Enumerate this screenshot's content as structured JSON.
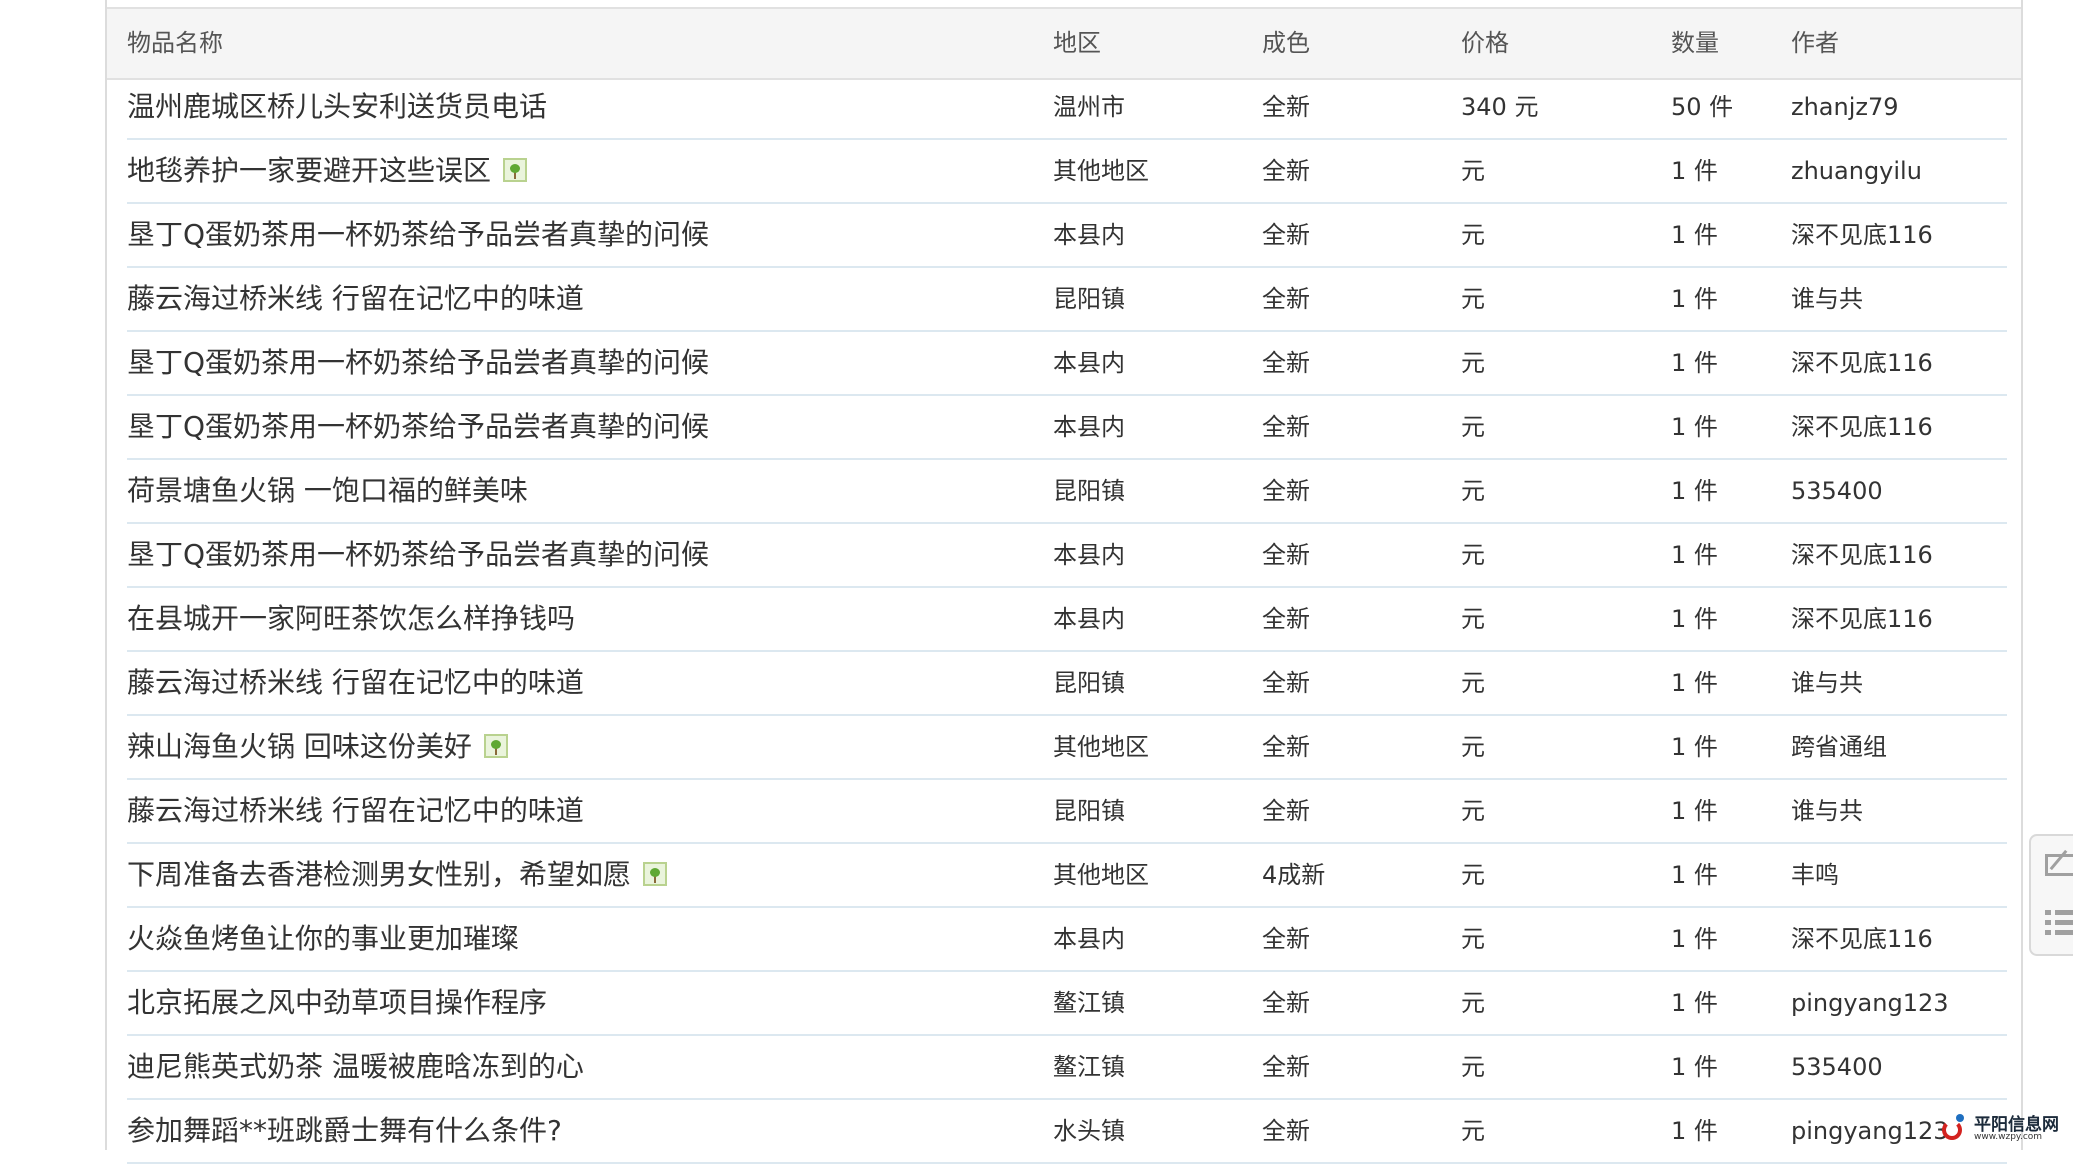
{
  "columns": {
    "title": "物品名称",
    "area": "地区",
    "condition": "成色",
    "price": "价格",
    "quantity": "数量",
    "author": "作者"
  },
  "rows": [
    {
      "title": "温州鹿城区桥儿头安利送货员电话",
      "has_image": false,
      "area": "温州市",
      "condition": "全新",
      "price": "340 元",
      "quantity": "50 件",
      "author": "zhanjz79"
    },
    {
      "title": "地毯养护一家要避开这些误区",
      "has_image": true,
      "area": "其他地区",
      "condition": "全新",
      "price": "元",
      "quantity": "1 件",
      "author": "zhuangyilu"
    },
    {
      "title": "垦丁Q蛋奶茶用一杯奶茶给予品尝者真挚的问候",
      "has_image": false,
      "area": "本县内",
      "condition": "全新",
      "price": "元",
      "quantity": "1 件",
      "author": "深不见底116"
    },
    {
      "title": "藤云海过桥米线 行留在记忆中的味道",
      "has_image": false,
      "area": "昆阳镇",
      "condition": "全新",
      "price": "元",
      "quantity": "1 件",
      "author": "谁与共"
    },
    {
      "title": "垦丁Q蛋奶茶用一杯奶茶给予品尝者真挚的问候",
      "has_image": false,
      "area": "本县内",
      "condition": "全新",
      "price": "元",
      "quantity": "1 件",
      "author": "深不见底116"
    },
    {
      "title": "垦丁Q蛋奶茶用一杯奶茶给予品尝者真挚的问候",
      "has_image": false,
      "area": "本县内",
      "condition": "全新",
      "price": "元",
      "quantity": "1 件",
      "author": "深不见底116"
    },
    {
      "title": "荷景塘鱼火锅 一饱口福的鲜美味",
      "has_image": false,
      "area": "昆阳镇",
      "condition": "全新",
      "price": "元",
      "quantity": "1 件",
      "author": "535400"
    },
    {
      "title": "垦丁Q蛋奶茶用一杯奶茶给予品尝者真挚的问候",
      "has_image": false,
      "area": "本县内",
      "condition": "全新",
      "price": "元",
      "quantity": "1 件",
      "author": "深不见底116"
    },
    {
      "title": "在县城开一家阿旺茶饮怎么样挣钱吗",
      "has_image": false,
      "area": "本县内",
      "condition": "全新",
      "price": "元",
      "quantity": "1 件",
      "author": "深不见底116"
    },
    {
      "title": "藤云海过桥米线 行留在记忆中的味道",
      "has_image": false,
      "area": "昆阳镇",
      "condition": "全新",
      "price": "元",
      "quantity": "1 件",
      "author": "谁与共"
    },
    {
      "title": "辣山海鱼火锅 回味这份美好",
      "has_image": true,
      "area": "其他地区",
      "condition": "全新",
      "price": "元",
      "quantity": "1 件",
      "author": "跨省通组"
    },
    {
      "title": "藤云海过桥米线 行留在记忆中的味道",
      "has_image": false,
      "area": "昆阳镇",
      "condition": "全新",
      "price": "元",
      "quantity": "1 件",
      "author": "谁与共"
    },
    {
      "title": "下周准备去香港检测男女性别，希望如愿",
      "has_image": true,
      "area": "其他地区",
      "condition": "4成新",
      "price": "元",
      "quantity": "1 件",
      "author": "丰鸣"
    },
    {
      "title": "火焱鱼烤鱼让你的事业更加璀璨",
      "has_image": false,
      "area": "本县内",
      "condition": "全新",
      "price": "元",
      "quantity": "1 件",
      "author": "深不见底116"
    },
    {
      "title": "北京拓展之风中劲草项目操作程序",
      "has_image": false,
      "area": "鳌江镇",
      "condition": "全新",
      "price": "元",
      "quantity": "1 件",
      "author": "pingyang123"
    },
    {
      "title": "迪尼熊英式奶茶 温暖被鹿晗冻到的心",
      "has_image": false,
      "area": "鳌江镇",
      "condition": "全新",
      "price": "元",
      "quantity": "1 件",
      "author": "535400"
    },
    {
      "title": "参加舞蹈**班跳爵士舞有什么条件?",
      "has_image": false,
      "area": "水头镇",
      "condition": "全新",
      "price": "元",
      "quantity": "1 件",
      "author": "pingyang123"
    }
  ],
  "side_tools": [
    "edit-icon",
    "list-icon"
  ],
  "watermark": {
    "name": "平阳信息网",
    "url": "www.wzpy.com"
  }
}
